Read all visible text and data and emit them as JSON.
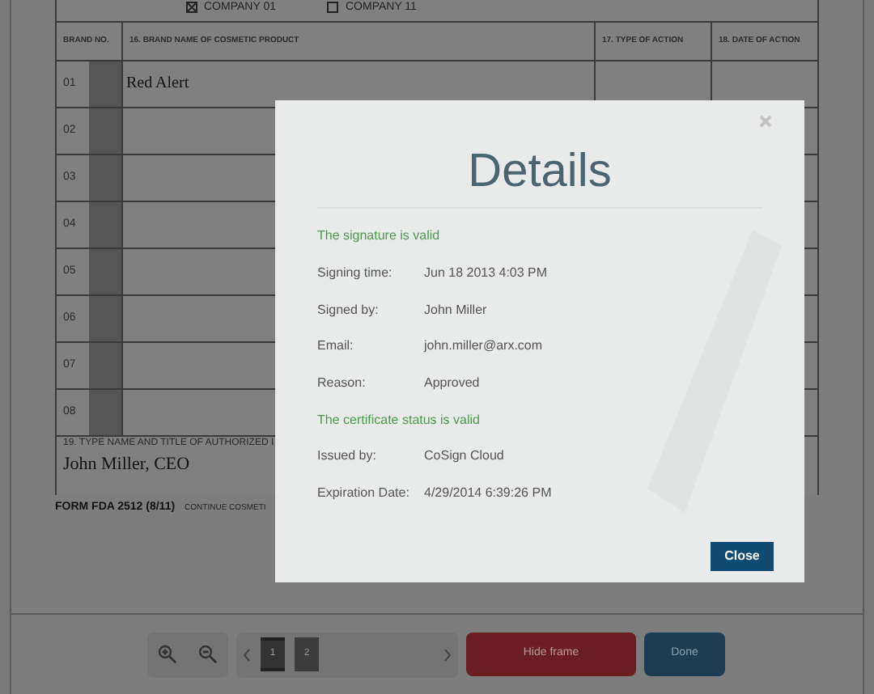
{
  "form": {
    "companies": [
      {
        "label": "COMPANY 01",
        "checked": true
      },
      {
        "label": "COMPANY 11",
        "checked": false
      }
    ],
    "columns": [
      "BRAND NO.",
      "16. BRAND NAME OF COSMETIC PRODUCT",
      "17. TYPE OF ACTION",
      "18. DATE OF ACTION"
    ],
    "rows": [
      {
        "no": "01",
        "name": "Red Alert"
      },
      {
        "no": "02"
      },
      {
        "no": "03"
      },
      {
        "no": "04"
      },
      {
        "no": "05"
      },
      {
        "no": "06"
      },
      {
        "no": "07"
      },
      {
        "no": "08"
      }
    ],
    "signer_label": "19. TYPE NAME AND TITLE OF AUTHORIZED I",
    "signer": "John Miller, CEO",
    "form_id": "FORM FDA 2512 (8/11)",
    "continue_note": "CONTINUE COSMETI"
  },
  "dialog": {
    "title": "Details",
    "items": [
      {
        "kind": "status",
        "text": "The signature is valid"
      },
      {
        "kind": "field",
        "label": "Signing time:",
        "value": "Jun 18 2013 4:03 PM"
      },
      {
        "kind": "field",
        "label": "Signed by:",
        "value": "John Miller"
      },
      {
        "kind": "field",
        "label": "Email:",
        "value": "john.miller@arx.com"
      },
      {
        "kind": "field",
        "label": "Reason:",
        "value": "Approved"
      },
      {
        "kind": "status",
        "text": "The certificate status is valid"
      },
      {
        "kind": "field",
        "label": "Issued by:",
        "value": "CoSign Cloud"
      },
      {
        "kind": "field",
        "label": "Expiration Date:",
        "value": "4/29/2014 6:39:26 PM"
      }
    ],
    "button": "Close"
  },
  "toolbar": {
    "pages": [
      {
        "label": "1",
        "selected": true
      },
      {
        "label": "2",
        "selected": false
      }
    ],
    "hide_button": "Hide frame",
    "done_button": "Done"
  }
}
